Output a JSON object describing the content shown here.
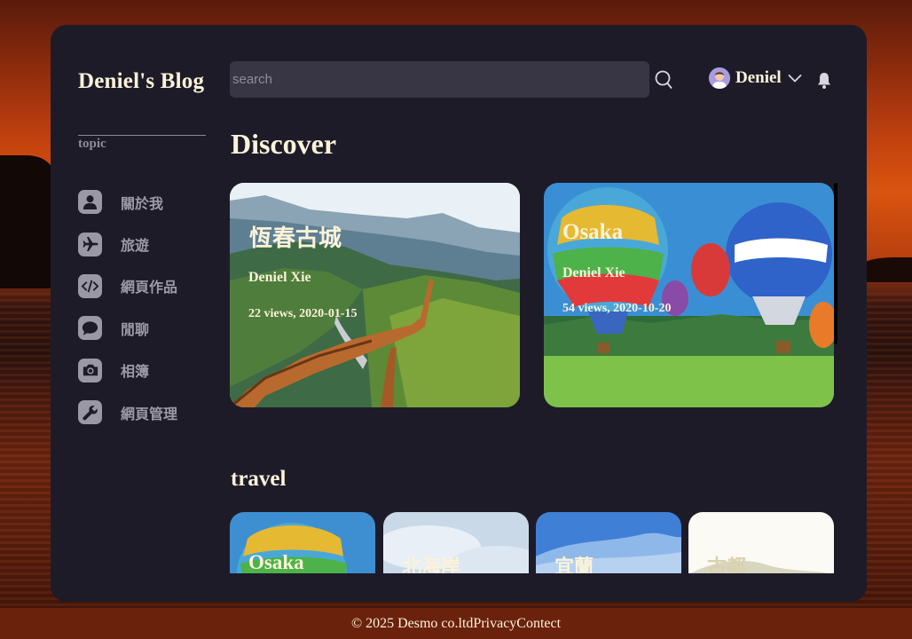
{
  "brand": "Deniel's Blog",
  "sidebar": {
    "heading": "topic",
    "items": [
      {
        "label": "關於我",
        "icon": "user-icon"
      },
      {
        "label": "旅遊",
        "icon": "airplane-icon"
      },
      {
        "label": "網頁作品",
        "icon": "code-icon"
      },
      {
        "label": "閒聊",
        "icon": "chat-bubble-icon"
      },
      {
        "label": "相簿",
        "icon": "camera-icon"
      },
      {
        "label": "網頁管理",
        "icon": "wrench-icon"
      }
    ]
  },
  "header": {
    "search_placeholder": "search",
    "user_name": "Deniel"
  },
  "discover": {
    "heading": "Discover",
    "cards": [
      {
        "title": "恆春古城",
        "author": "Deniel Xie",
        "meta": "22 views, 2020-01-15"
      },
      {
        "title": "Osaka",
        "author": "Deniel Xie",
        "meta": "54 views, 2020-10-20"
      }
    ]
  },
  "travel": {
    "heading": "travel",
    "cards": [
      {
        "title": "Osaka"
      },
      {
        "title": "北海岸"
      },
      {
        "title": "宜蘭"
      },
      {
        "title": "古都"
      }
    ]
  },
  "footer": {
    "copyright": "© 2025 Desmo co.ltd",
    "privacy": "Privacy",
    "contect": "Contect"
  },
  "colors": {
    "panel": "#1e1b29",
    "accent_text": "#fbf3d9",
    "muted_text": "#9d9aa8",
    "search_bg": "#383645",
    "footer_bg": "#6b220d"
  }
}
